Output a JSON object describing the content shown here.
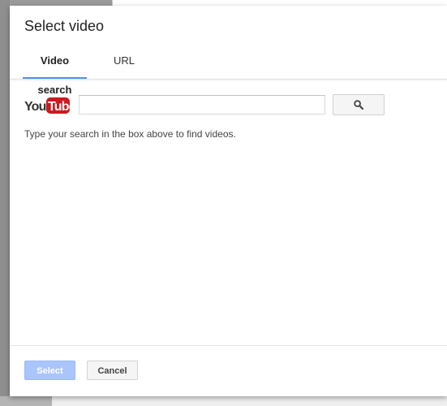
{
  "dialog": {
    "title": "Select video"
  },
  "tabs": [
    {
      "label": "Video search",
      "active": true
    },
    {
      "label": "URL",
      "active": false
    }
  ],
  "search": {
    "logo_text": "YouTube",
    "value": "",
    "placeholder": "",
    "button_icon": "search-icon",
    "hint": "Type your search in the box above to find videos."
  },
  "footer": {
    "select_label": "Select",
    "cancel_label": "Cancel"
  },
  "colors": {
    "accent": "#4d90fe",
    "select_disabled": "#aac5fb",
    "youtube_red": "#cc181e"
  }
}
